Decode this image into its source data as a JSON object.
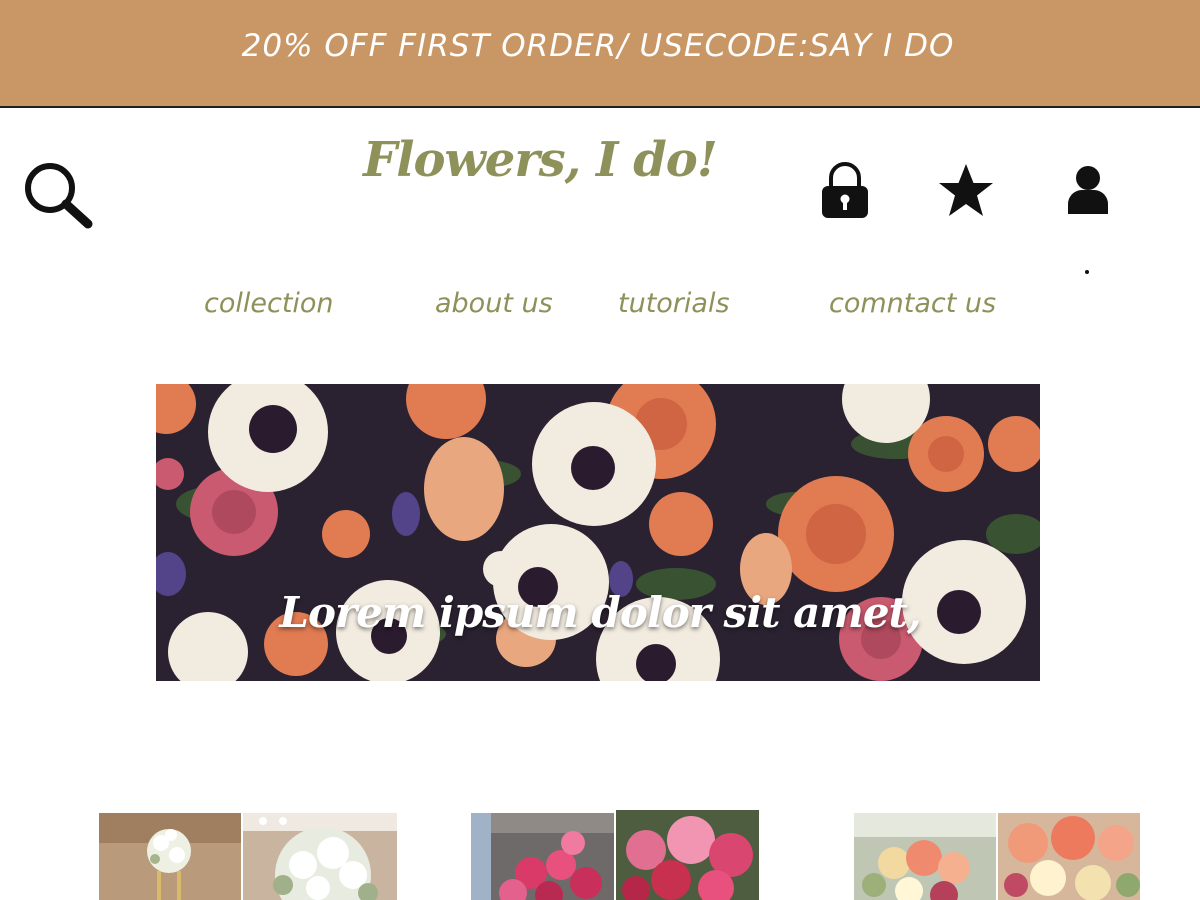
{
  "promo": {
    "text": "20% OFF FIRST ORDER/ USECODE:SAY I DO"
  },
  "header": {
    "brand": "Flowers, I do!",
    "icons": [
      "search-icon",
      "lock-icon",
      "star-icon",
      "user-icon"
    ]
  },
  "nav": {
    "items": [
      {
        "label": "collection"
      },
      {
        "label": "about us"
      },
      {
        "label": "tutorials"
      },
      {
        "label": "comntact us"
      }
    ]
  },
  "hero": {
    "caption": "Lorem ipsum dolor sit amet,"
  },
  "colors": {
    "promo_bg": "#c99765",
    "brand": "#8e915a",
    "nav": "#8e915a",
    "hero_bg": "#2b2231"
  }
}
